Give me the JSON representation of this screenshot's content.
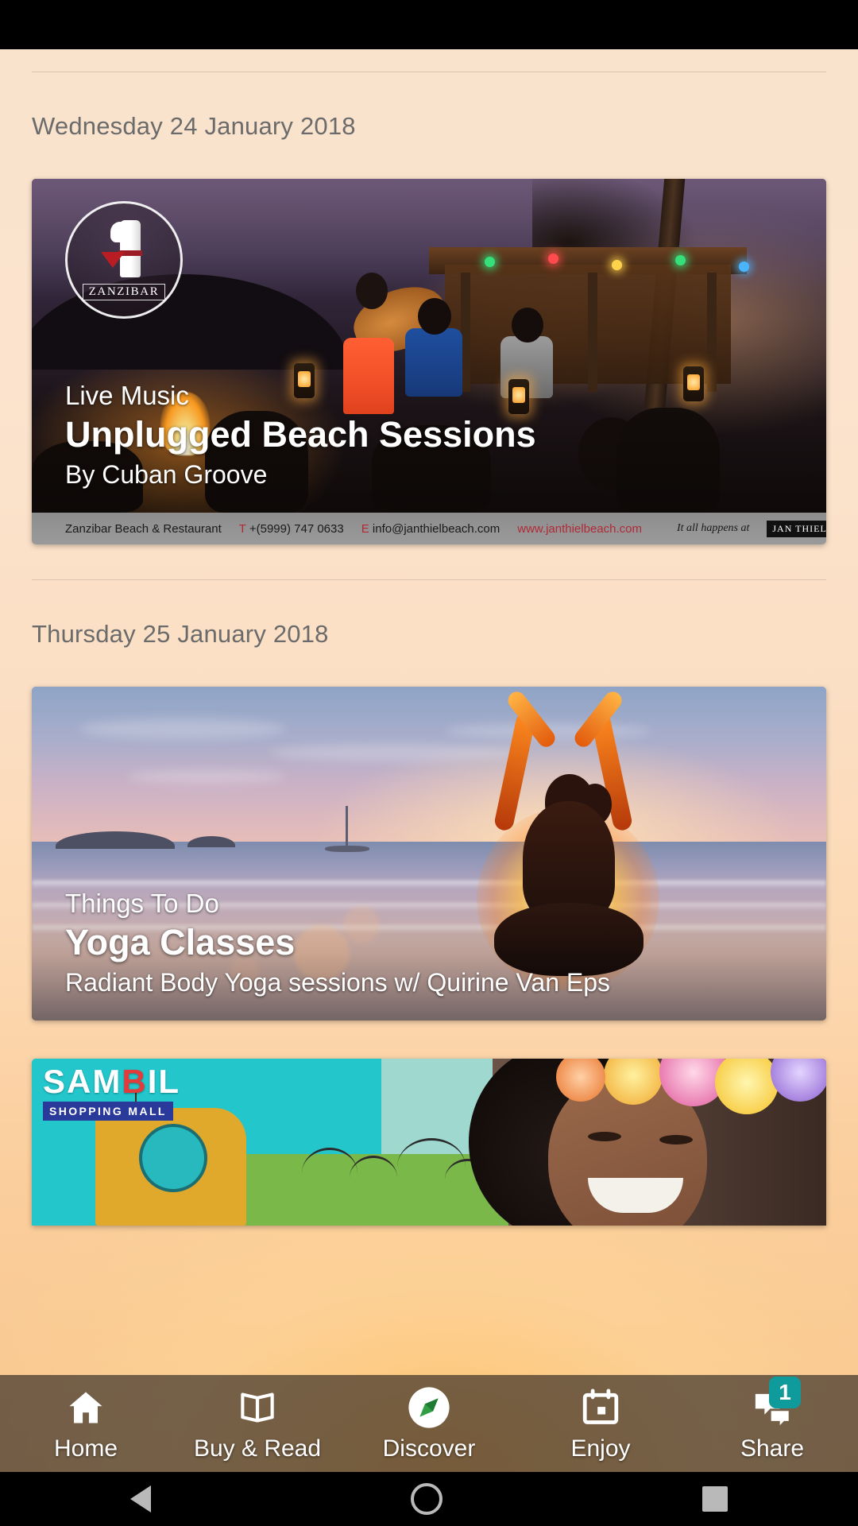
{
  "app": {
    "days": [
      {
        "date_label": "Wednesday 24 January 2018",
        "event": {
          "category": "Live Music",
          "title": "Unplugged Beach Sessions",
          "subtitle": "By Cuban Groove",
          "venue_strip": {
            "venue": "Zanzibar Beach & Restaurant",
            "phone_label": "T",
            "phone": "+(5999) 747 0633",
            "email_label": "E",
            "email": "info@janthielbeach.com",
            "website": "www.janthielbeach.com",
            "tagline": "It all happens at",
            "partner_badge": "JAN THIEL BEACH"
          },
          "logo_text": "ZANZIBAR"
        }
      },
      {
        "date_label": "Thursday 25 January 2018",
        "event": {
          "category": "Things To Do",
          "title": "Yoga Classes",
          "subtitle": "Radiant Body Yoga sessions w/ Quirine Van Eps"
        }
      }
    ],
    "promo_card": {
      "brand_part1": "SAM",
      "brand_part2": "B",
      "brand_part3": "IL",
      "brand_sub": "SHOPPING MALL"
    },
    "bottom_nav": {
      "items": [
        {
          "label": "Home",
          "icon": "home-icon",
          "badge": null
        },
        {
          "label": "Buy & Read",
          "icon": "book-icon",
          "badge": null
        },
        {
          "label": "Discover",
          "icon": "compass-icon",
          "badge": null
        },
        {
          "label": "Enjoy",
          "icon": "calendar-icon",
          "badge": null
        },
        {
          "label": "Share",
          "icon": "chat-icon",
          "badge": "1"
        }
      ],
      "badge_color": "#0f9b9b"
    },
    "system_nav": {
      "back": "back-triangle",
      "home": "home-circle",
      "recents": "recents-square"
    }
  }
}
